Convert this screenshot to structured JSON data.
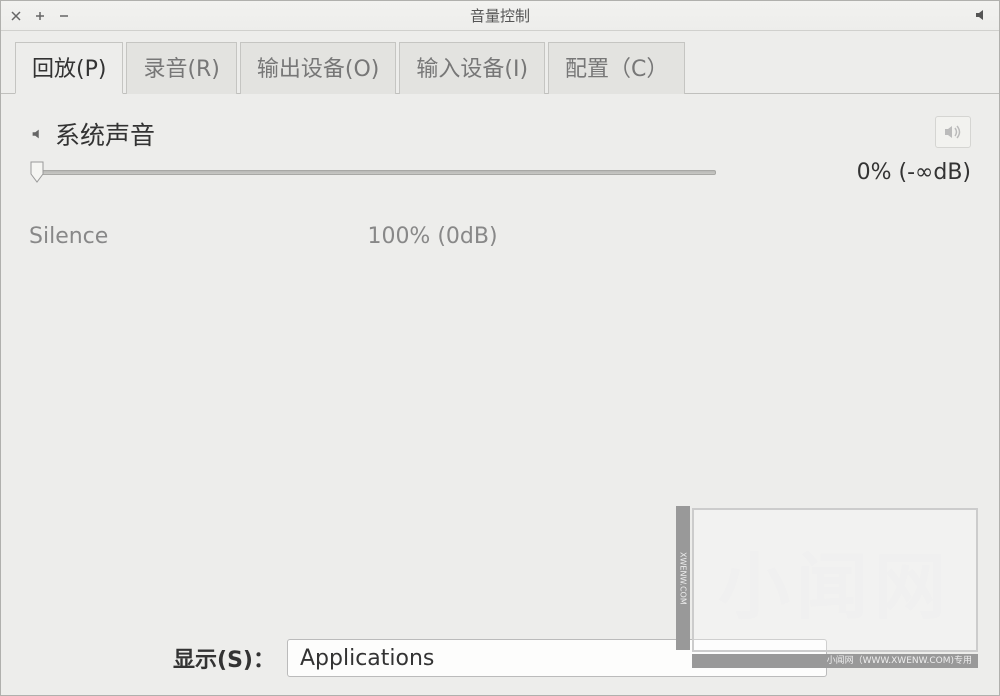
{
  "window": {
    "title": "音量控制"
  },
  "tabs": [
    {
      "label": "回放(P)"
    },
    {
      "label": "录音(R)"
    },
    {
      "label": "输出设备(O)"
    },
    {
      "label": "输入设备(I)"
    },
    {
      "label": "配置（C）"
    }
  ],
  "stream": {
    "title": "系统声音",
    "silence_label": "Silence",
    "mid_label": "100% (0dB)",
    "level_text": "0% (-∞dB)"
  },
  "bottom": {
    "show_label": "显示(S)：",
    "selected": "Applications"
  },
  "watermark": {
    "text": "小闻网",
    "footer": "小闻网（WWW.XWENW.COM)专用",
    "side": "XWENW.COM"
  }
}
